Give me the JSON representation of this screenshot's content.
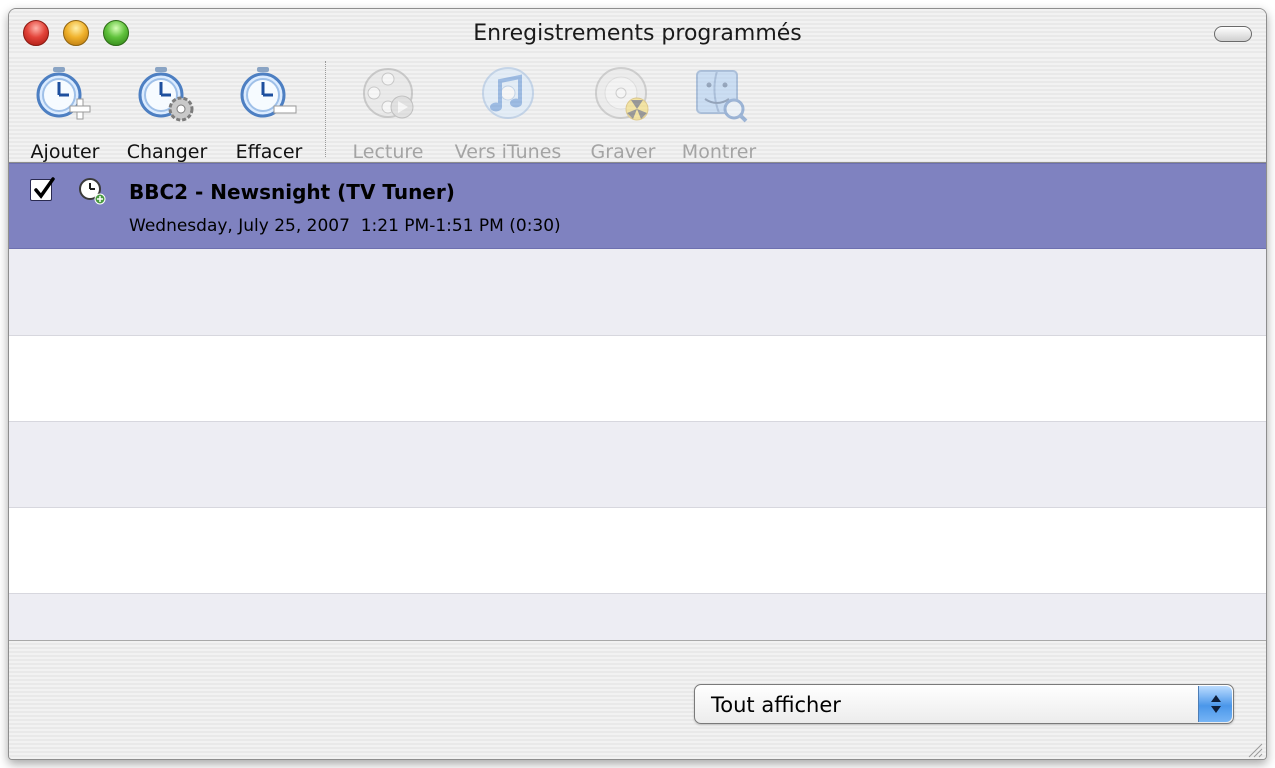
{
  "window": {
    "title": "Enregistrements programmés"
  },
  "toolbar": {
    "items": [
      {
        "label": "Ajouter",
        "icon": "timer-add-icon",
        "enabled": true
      },
      {
        "label": "Changer",
        "icon": "timer-gear-icon",
        "enabled": true
      },
      {
        "label": "Effacer",
        "icon": "timer-remove-icon",
        "enabled": true
      },
      {
        "label": "Lecture",
        "icon": "film-reel-play-icon",
        "enabled": false
      },
      {
        "label": "Vers iTunes",
        "icon": "itunes-note-icon",
        "enabled": false
      },
      {
        "label": "Graver",
        "icon": "burn-disc-icon",
        "enabled": false
      },
      {
        "label": "Montrer",
        "icon": "finder-reveal-icon",
        "enabled": false
      }
    ]
  },
  "list": {
    "rows": [
      {
        "checked": true,
        "title": "BBC2 - Newsnight (TV Tuner)",
        "schedule": "Wednesday, July 25, 2007  1:21 PM-1:51 PM (0:30)",
        "selected": true
      }
    ]
  },
  "filter": {
    "selected": "Tout afficher"
  },
  "colors": {
    "selection": "#7f82c0",
    "alt_row": "#ededf3"
  }
}
